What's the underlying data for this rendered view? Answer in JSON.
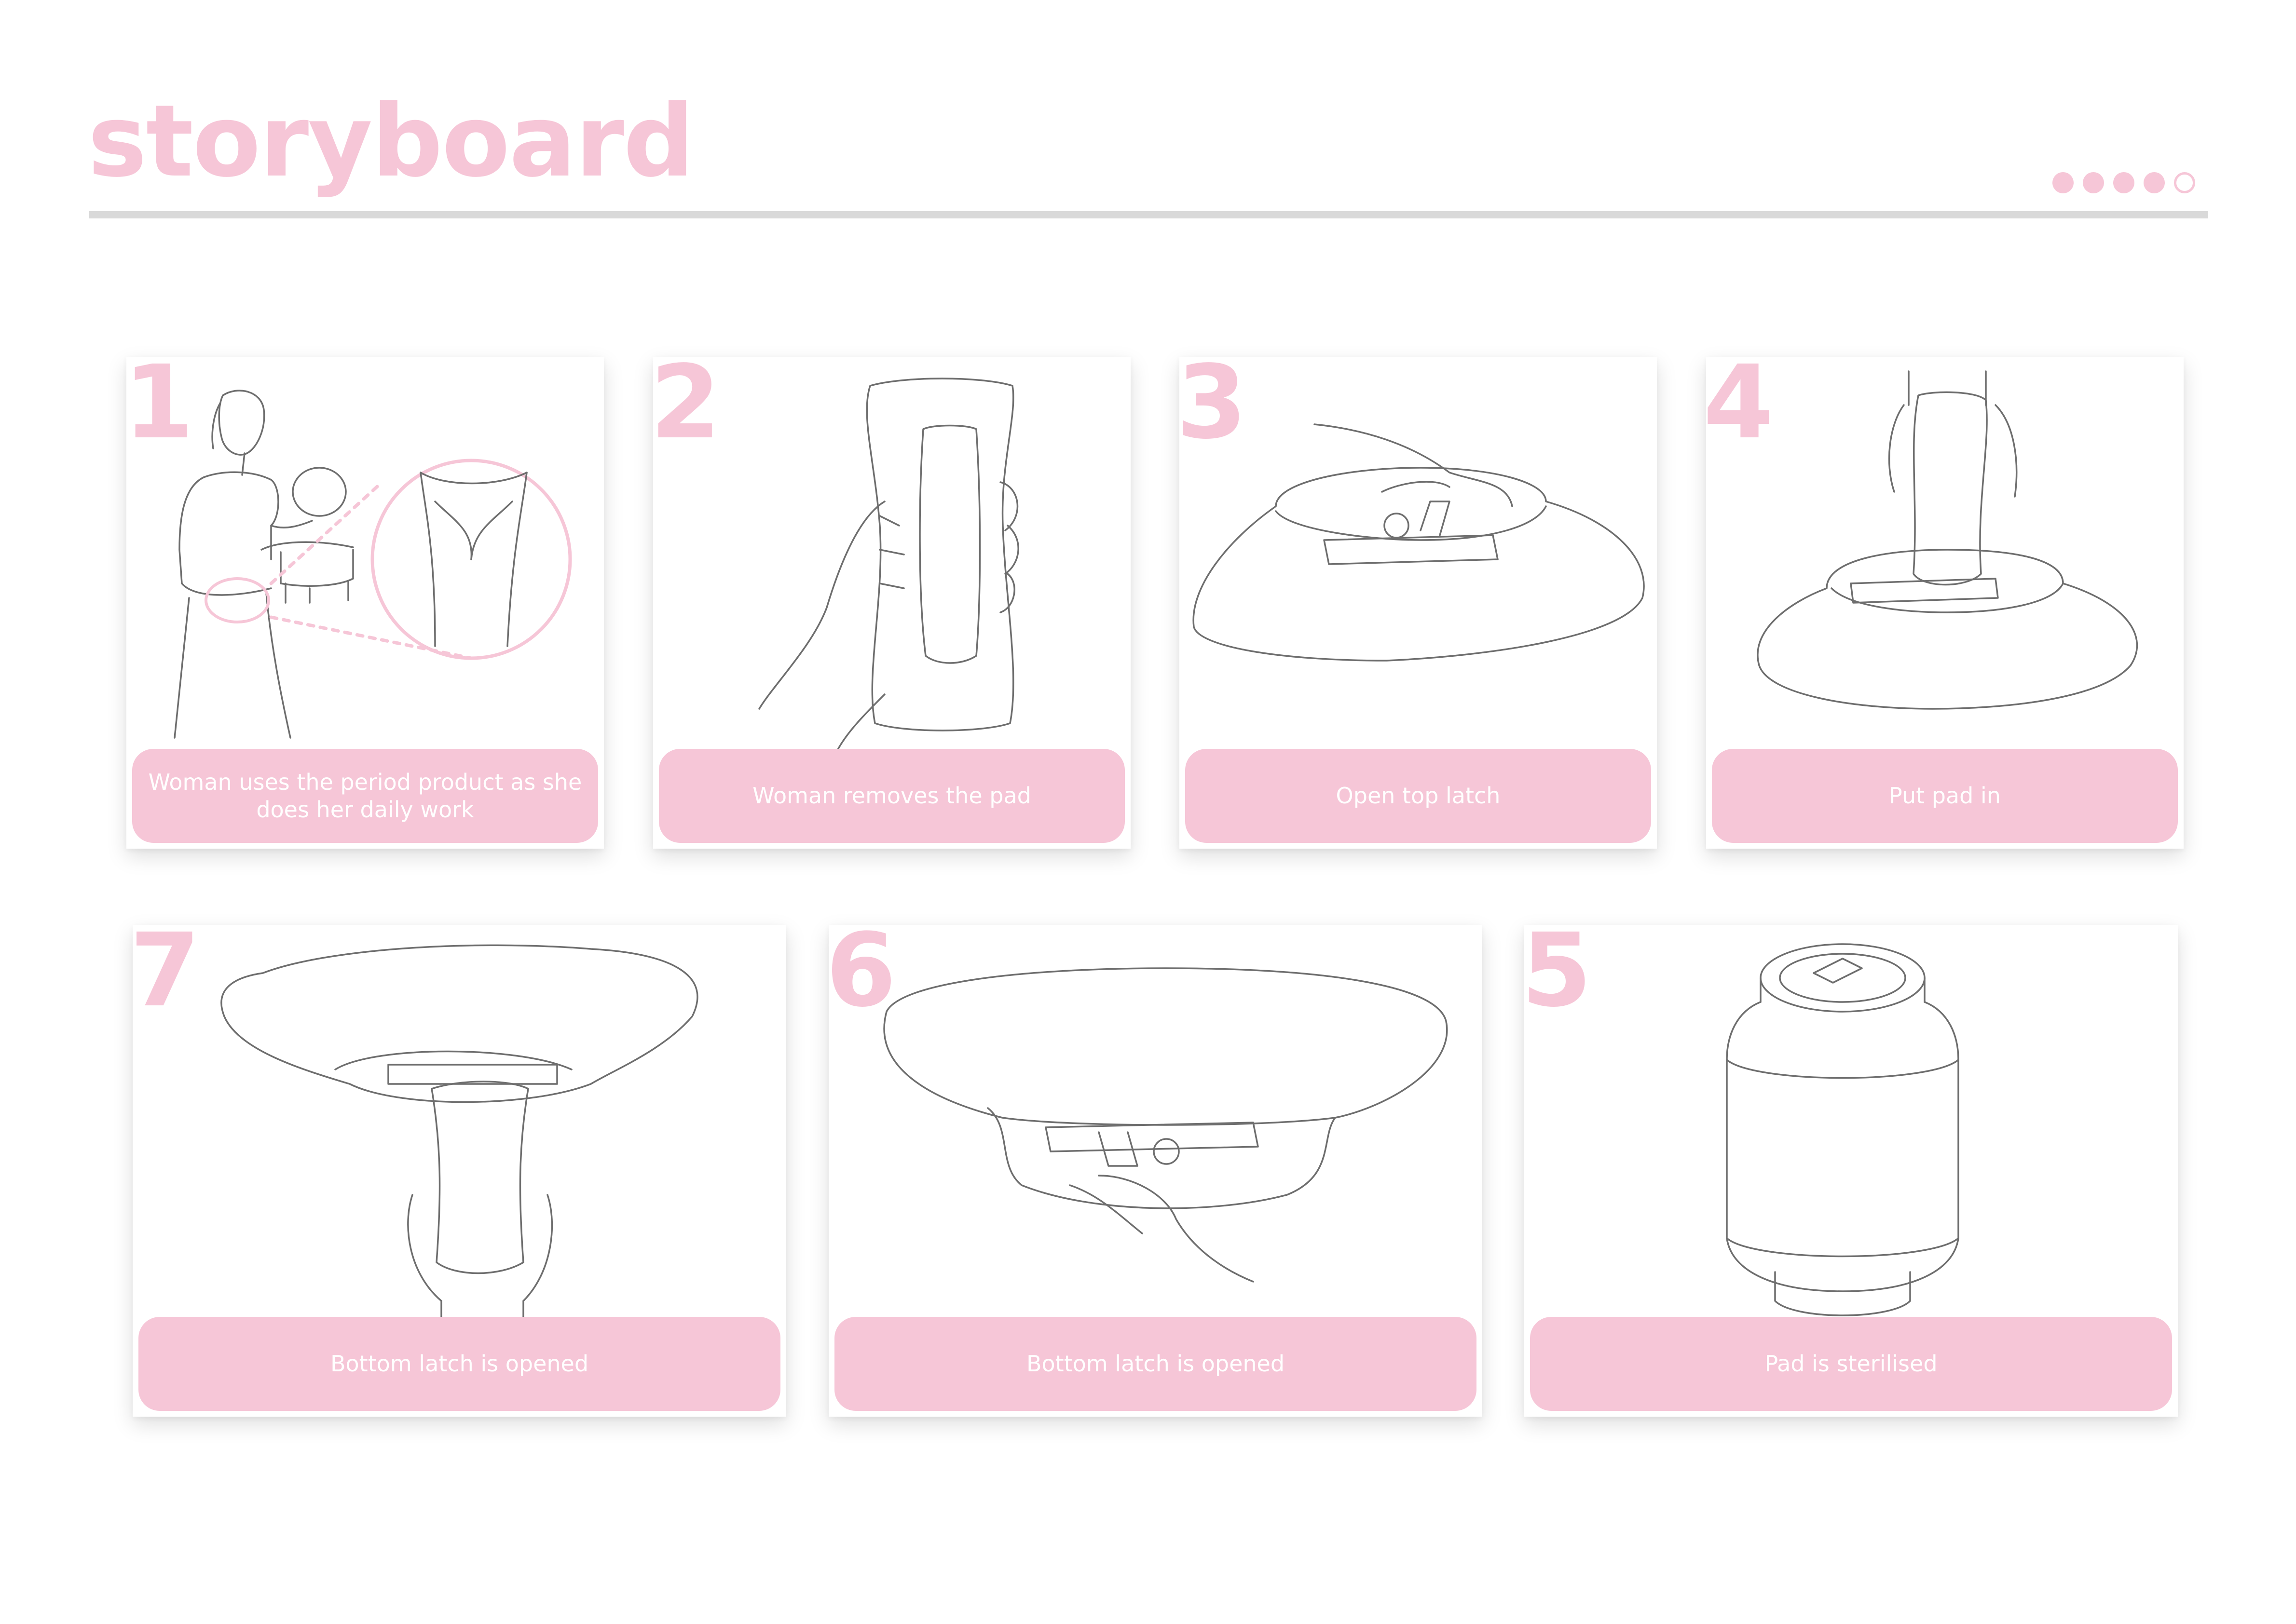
{
  "colors": {
    "accent": "#f6c6d7",
    "rule": "#d9d9d9"
  },
  "header": {
    "title": "storyboard",
    "progress_dots": {
      "total": 5,
      "filled": 4
    }
  },
  "panels": [
    {
      "number": "1",
      "caption": "Woman uses the period product as she does her daily work"
    },
    {
      "number": "2",
      "caption": "Woman removes the pad"
    },
    {
      "number": "3",
      "caption": "Open top latch"
    },
    {
      "number": "4",
      "caption": "Put pad in"
    },
    {
      "number": "7",
      "caption": "Bottom latch is opened"
    },
    {
      "number": "6",
      "caption": "Bottom latch is opened"
    },
    {
      "number": "5",
      "caption": "Pad is sterilised"
    }
  ]
}
